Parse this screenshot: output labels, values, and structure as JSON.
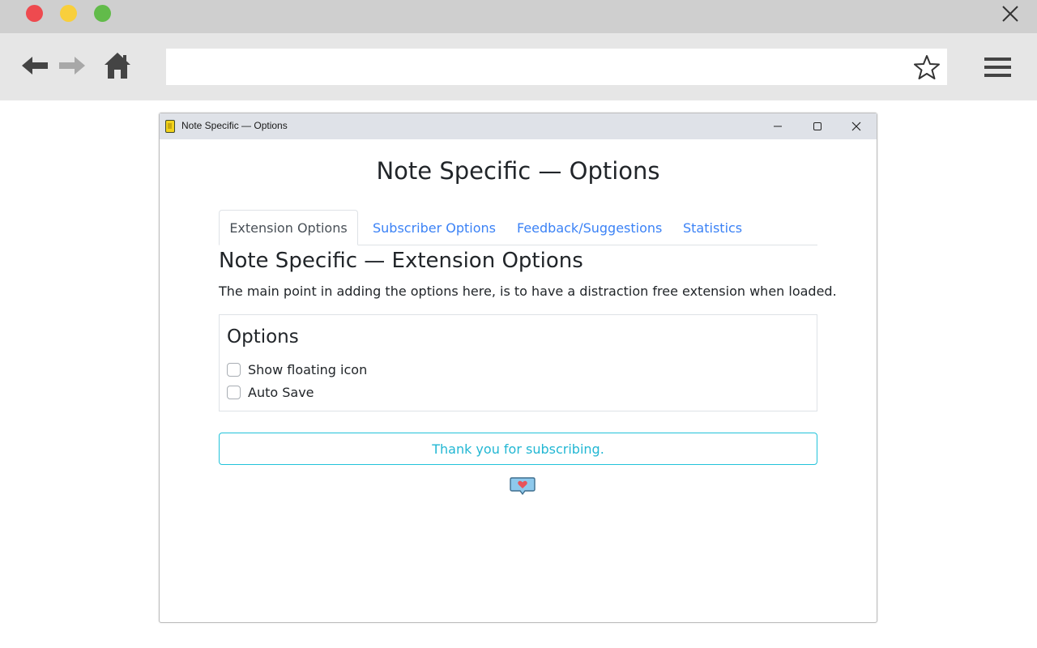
{
  "browser": {
    "icons": {
      "back": "back-arrow-icon",
      "forward": "forward-arrow-icon",
      "home": "home-icon",
      "bookmark": "star-icon",
      "menu": "hamburger-menu-icon",
      "close": "close-icon"
    },
    "url": ""
  },
  "window": {
    "title": "Note Specific — Options"
  },
  "page": {
    "title": "Note Specific — Options",
    "tabs": [
      {
        "label": "Extension Options",
        "active": true
      },
      {
        "label": "Subscriber Options",
        "active": false
      },
      {
        "label": "Feedback/Suggestions",
        "active": false
      },
      {
        "label": "Statistics",
        "active": false
      }
    ],
    "section": {
      "heading": "Note Specific — Extension Options",
      "description": "The main point in adding the options here, is to have a distraction free extension when loaded."
    },
    "options": {
      "legend": "Options",
      "items": [
        {
          "label": "Show floating icon",
          "checked": false
        },
        {
          "label": "Auto Save",
          "checked": false
        }
      ]
    },
    "subscription_message": "Thank you for subscribing.",
    "feedback_icon": "heart-speech-bubble-icon"
  },
  "colors": {
    "link": "#3b82f6",
    "info": "#22c3da",
    "traffic_red": "#ee4a4f",
    "traffic_yellow": "#f8cf3c",
    "traffic_green": "#62bb4a"
  }
}
